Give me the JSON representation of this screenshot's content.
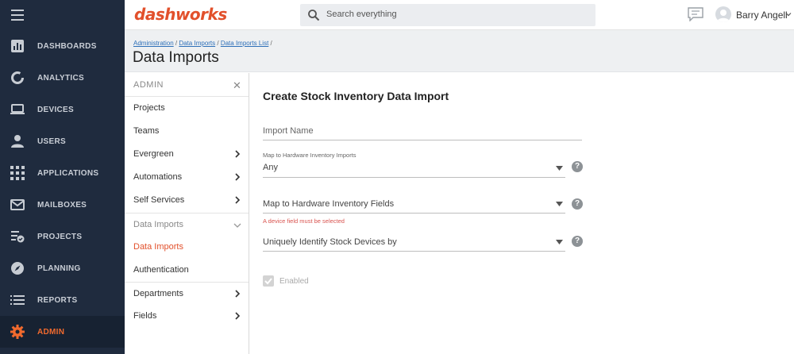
{
  "nav": {
    "items": [
      {
        "label": "DASHBOARDS",
        "icon": "bar-chart-icon"
      },
      {
        "label": "ANALYTICS",
        "icon": "donut-icon"
      },
      {
        "label": "DEVICES",
        "icon": "laptop-icon"
      },
      {
        "label": "USERS",
        "icon": "user-icon"
      },
      {
        "label": "APPLICATIONS",
        "icon": "grid-icon"
      },
      {
        "label": "MAILBOXES",
        "icon": "mail-icon"
      },
      {
        "label": "PROJECTS",
        "icon": "project-icon"
      },
      {
        "label": "PLANNING",
        "icon": "compass-icon"
      },
      {
        "label": "REPORTS",
        "icon": "list-icon"
      },
      {
        "label": "ADMIN",
        "icon": "gear-icon"
      }
    ],
    "active_color": "#f26a2e"
  },
  "topbar": {
    "logo": "dashworks",
    "search_placeholder": "Search everything",
    "user_name": "Barry Angell"
  },
  "header": {
    "breadcrumb": [
      "Administration",
      "Data Imports",
      "Data Imports List"
    ],
    "title": "Data Imports"
  },
  "submenu": {
    "title": "ADMIN",
    "items": [
      {
        "label": "Projects"
      },
      {
        "label": "Teams"
      },
      {
        "label": "Evergreen"
      },
      {
        "label": "Automations"
      },
      {
        "label": "Self Services"
      },
      {
        "label": "Data Imports"
      },
      {
        "label": "Data Imports"
      },
      {
        "label": "Authentication"
      },
      {
        "label": "Departments"
      },
      {
        "label": "Fields"
      }
    ]
  },
  "form": {
    "title": "Create Stock Inventory Data Import",
    "import_name_placeholder": "Import Name",
    "hw_imports_label": "Map to Hardware Inventory Imports",
    "hw_imports_value": "Any",
    "hw_fields_placeholder": "Map to Hardware Inventory Fields",
    "hw_fields_error": "A device field must be selected",
    "identify_placeholder": "Uniquely Identify Stock Devices by",
    "enabled_label": "Enabled",
    "enabled_checked": true,
    "help_glyph": "?"
  }
}
